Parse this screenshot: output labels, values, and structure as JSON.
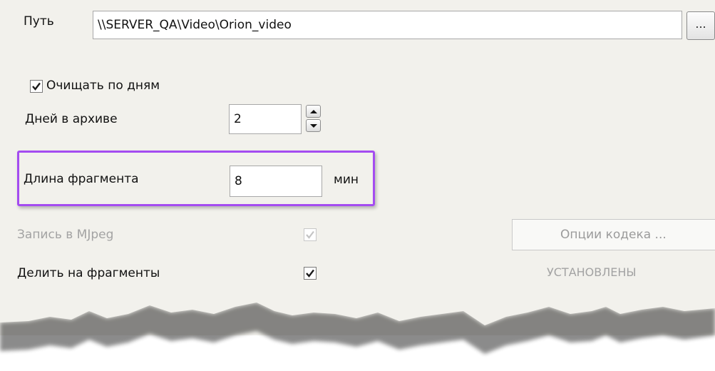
{
  "path": {
    "label": "Путь",
    "value": "\\\\SERVER_QA\\Video\\Orion_video",
    "browse_label": "..."
  },
  "clean_by_days": {
    "label": "Очищать по  дням",
    "checked": true
  },
  "days_in_archive": {
    "label": "Дней в архиве",
    "value": "2"
  },
  "fragment_length": {
    "label": "Длина фрагмента",
    "value": "8",
    "unit": "мин"
  },
  "mjpeg_record": {
    "label": "Запись в MJpeg",
    "checked": true,
    "disabled": true
  },
  "split_fragments": {
    "label": "Делить на фрагменты",
    "checked": true
  },
  "codec": {
    "button_label": "Опции кодека ...",
    "status": "УСТАНОВЛЕНЫ"
  },
  "icons": [
    "checkmark-icon",
    "spin-up-icon",
    "spin-down-icon"
  ],
  "colors": {
    "highlight": "#a44cf0",
    "panel": "#f2f1ec",
    "disabled_text": "#a3a3a3"
  }
}
